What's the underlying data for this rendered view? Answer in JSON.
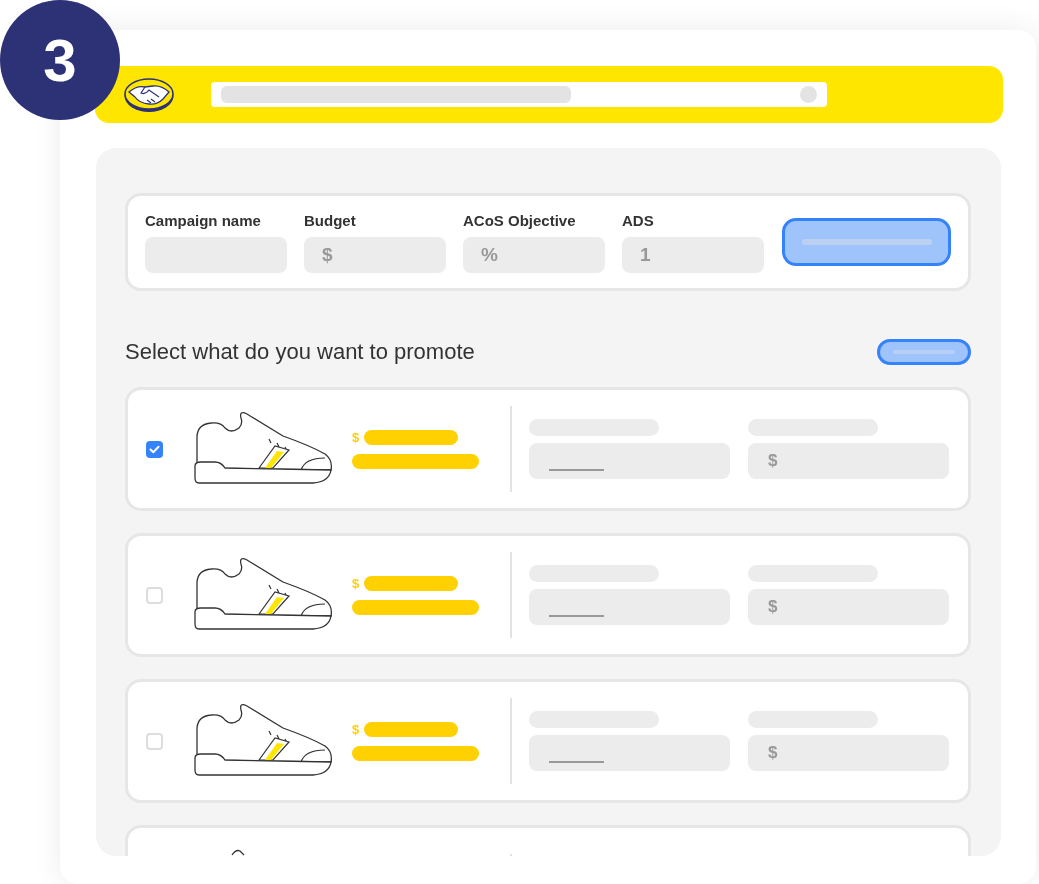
{
  "step_badge": "3",
  "campaign_form": {
    "fields": [
      {
        "label": "Campaign name"
      },
      {
        "label": "Budget",
        "symbol": "$"
      },
      {
        "label": "ACoS Objective",
        "symbol": "%"
      },
      {
        "label": "ADS",
        "symbol": "1"
      }
    ]
  },
  "section_title": "Select what do you want to promote",
  "products": [
    {
      "kind": "full",
      "checked": true,
      "price_symbol": "$",
      "amount_symbol": "$"
    },
    {
      "kind": "full",
      "checked": false,
      "price_symbol": "$",
      "amount_symbol": "$"
    },
    {
      "kind": "full",
      "checked": false,
      "price_symbol": "$",
      "amount_symbol": "$"
    },
    {
      "kind": "cut"
    }
  ]
}
